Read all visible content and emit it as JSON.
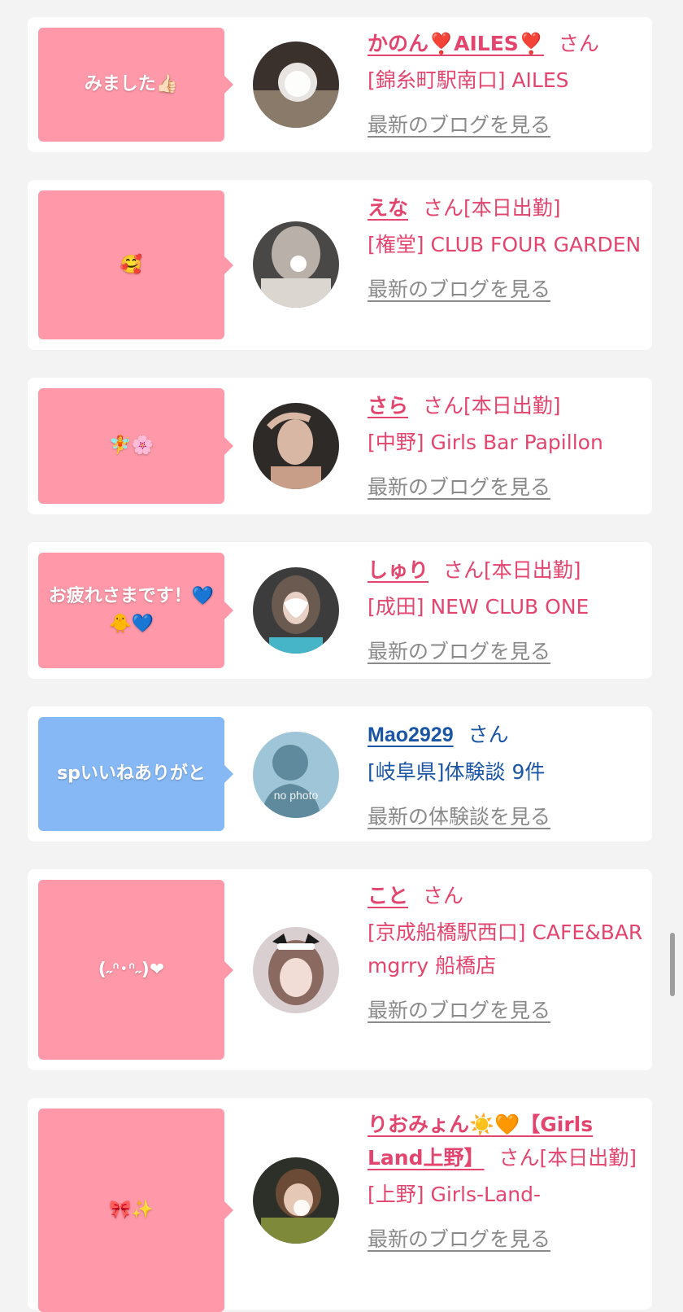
{
  "cards": [
    {
      "message": "みました👍🏻",
      "name": "かのん❣️AILES❣️",
      "san": "さん",
      "status": "",
      "shop": "[錦糸町駅南口] AILES",
      "link": "最新のブログを見る"
    },
    {
      "message": "🥰",
      "name": "えな",
      "san": "さん",
      "status": "[本日出勤]",
      "shop": "[権堂] CLUB FOUR GARDEN",
      "link": "最新のブログを見る"
    },
    {
      "message": "🧚🌸",
      "name": "さら",
      "san": "さん",
      "status": "[本日出勤]",
      "shop": "[中野] Girls Bar Papillon",
      "link": "最新のブログを見る"
    },
    {
      "message": "お疲れさまです！💙🐥💙",
      "name": "しゅり",
      "san": "さん",
      "status": "[本日出勤]",
      "shop": "[成田] NEW CLUB ONE",
      "link": "最新のブログを見る"
    },
    {
      "message": "spいいねありがと",
      "name": "Mao2929",
      "san": "さん",
      "status": "",
      "shop": "[岐阜県]体験談 9件",
      "link": "最新の体験談を見る",
      "avatar_label": "no photo"
    },
    {
      "message": "(˶ᐢ･ᐢ˶)❤",
      "name": "こと",
      "san": "さん",
      "status": "",
      "shop": "[京成船橋駅西口] CAFE&BAR mgrry 船橋店",
      "link": "最新のブログを見る"
    },
    {
      "message": "🎀✨",
      "name": "りおみょん☀️🧡【Girls Land上野】",
      "san": "さん",
      "status": "[本日出勤]",
      "shop": "[上野] Girls-Land-",
      "link": "最新のブログを見る"
    }
  ],
  "colors": {
    "pink_bubble": "#ff98a8",
    "blue_bubble": "#86b8f6",
    "pink_text": "#e3456f",
    "blue_text": "#1a55a6",
    "link_gray": "#8a8a8a"
  }
}
